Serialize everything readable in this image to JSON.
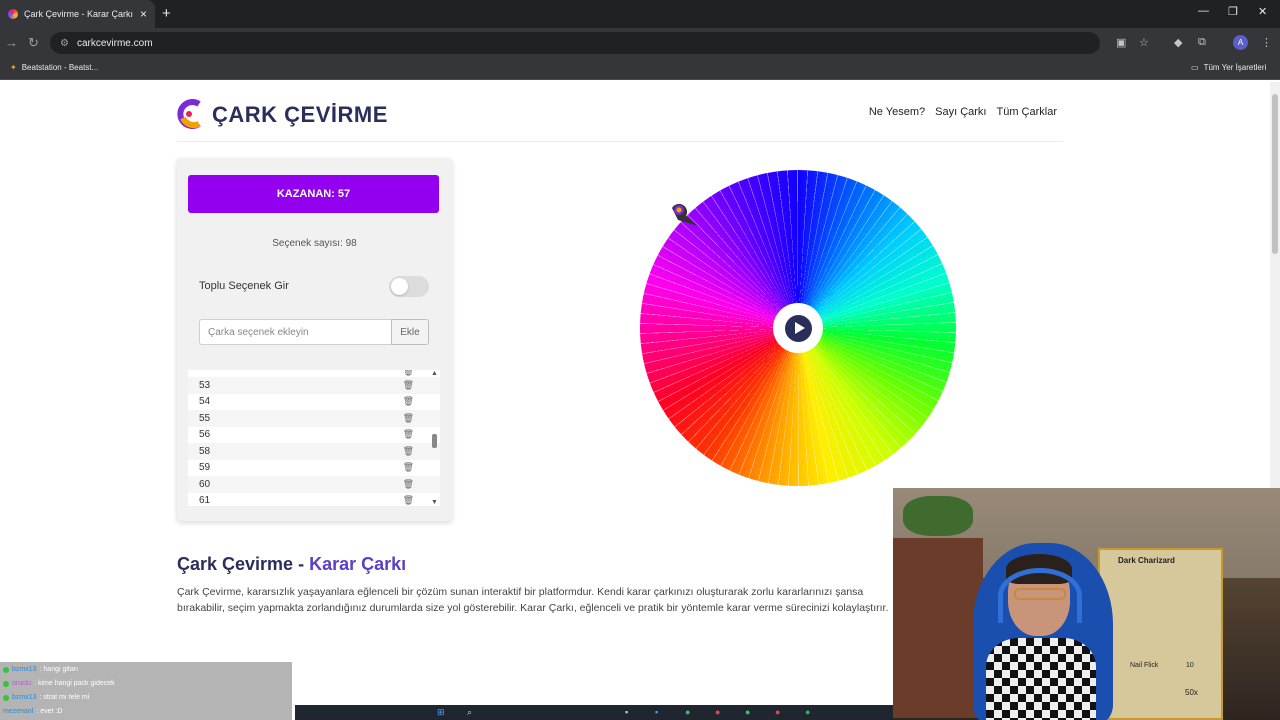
{
  "browser": {
    "tab_title": "Çark Çevirme - Karar Çarkı",
    "tab_close": "×",
    "new_tab": "+",
    "window_controls": [
      "—",
      "❐",
      "✕"
    ],
    "url": "carkcevirme.com",
    "bookmark_left": "Beatstation - Beatst...",
    "bookmark_right": "Tüm Yer İşaretleri",
    "profile_initial": "A"
  },
  "site": {
    "brand": "ÇARK ÇEVİRME",
    "nav": [
      "Ne Yesem?",
      "Sayı Çarkı",
      "Tüm Çarklar"
    ]
  },
  "panel": {
    "winner": "KAZANAN: 57",
    "count": "Seçenek sayısı: 98",
    "toggle_label": "Toplu Seçenek Gir",
    "input_placeholder": "Çarka seçenek ekleyin",
    "add_button": "Ekle",
    "visible_items": [
      "53",
      "54",
      "55",
      "56",
      "58",
      "59",
      "60",
      "61"
    ]
  },
  "wheel": {
    "segments": 98
  },
  "article": {
    "title_part1": "Çark Çevirme - ",
    "title_part2": "Karar Çarkı",
    "body": "Çark Çevirme, kararsızlık yaşayanlara eğlenceli bir çözüm sunan interaktif bir platformdur. Kendi karar çarkınızı oluşturarak zorlu kararlarınızı şansa bırakabilir, seçim yapmakta zorlandığınız durumlarda size yol gösterebilir. Karar Çarkı, eğlenceli ve pratik bir yöntemle karar verme sürecinizi kolaylaştırır."
  },
  "webcam": {
    "card_title": "Dark Charizard",
    "card_move": "Nail Flick",
    "card_hp": "10",
    "card_amount": "50x"
  },
  "chat": [
    {
      "user": "bzmx13",
      "text": ": hangi gitarı"
    },
    {
      "user": "oruclu",
      "text": ": kime hangi pack gidecek"
    },
    {
      "user": "bzmx13",
      "text": ": strat mı tele mi"
    },
    {
      "user": "mezenanl",
      "text": ": evet :D"
    }
  ]
}
